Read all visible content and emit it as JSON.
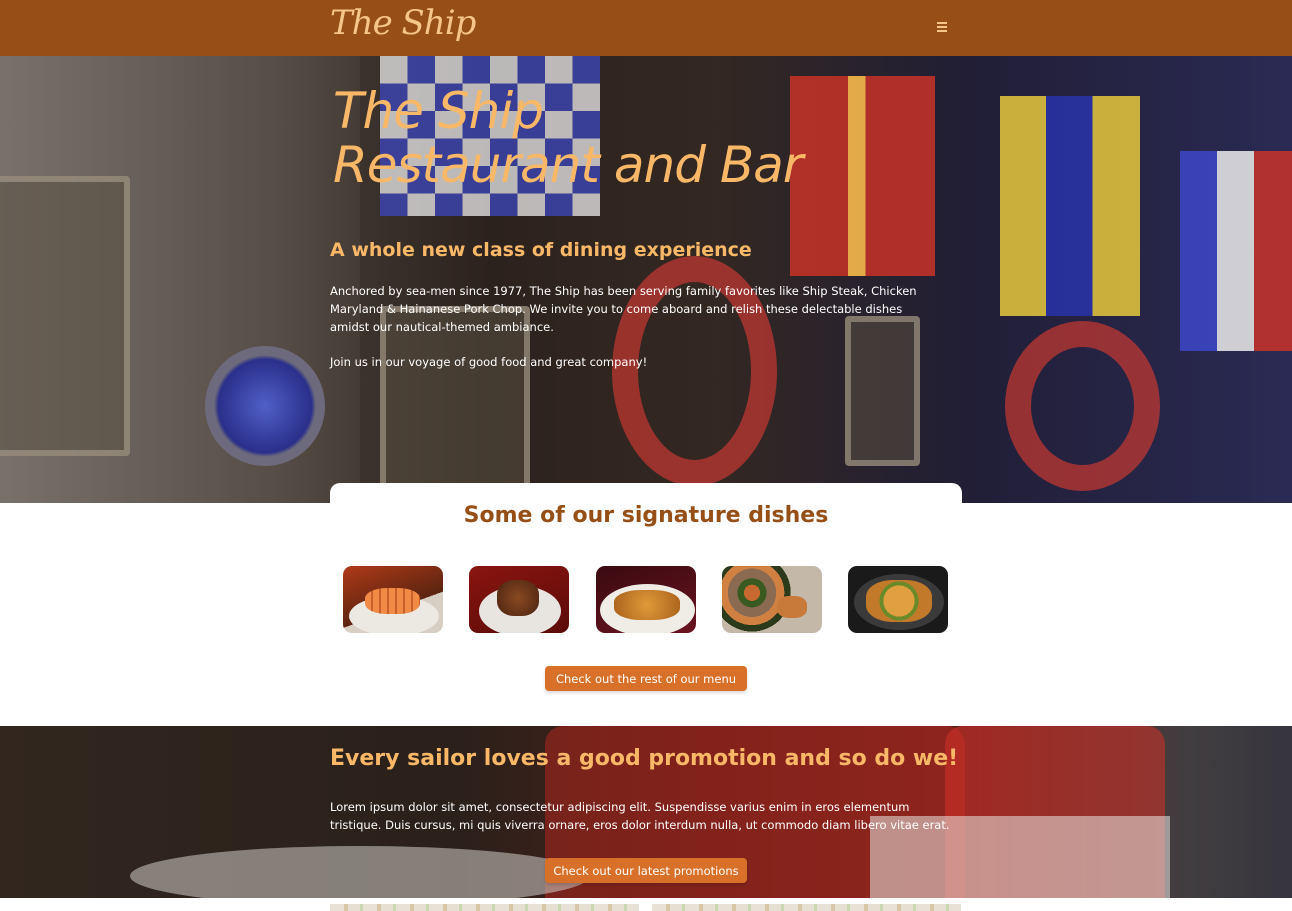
{
  "navbar": {
    "logo": "The Ship",
    "menu_icon": "hamburger-menu-icon"
  },
  "hero": {
    "title_line1": "The Ship",
    "title_line2": "Restaurant and Bar",
    "subtitle": "A whole new class of dining experience",
    "paragraph1": "Anchored by sea-men since 1977, The Ship has been serving family favorites like Ship Steak, Chicken Maryland & Hainanese Pork Chop. We invite you to come aboard and relish these delectable dishes amidst our nautical-themed ambiance.",
    "paragraph2": "Join us in our voyage of good food and great company!"
  },
  "signature": {
    "title": "Some of our signature dishes",
    "dishes": [
      {
        "name": "grilled-salmon-dish"
      },
      {
        "name": "braised-meat-dish"
      },
      {
        "name": "fried-cutlet-dish"
      },
      {
        "name": "baked-oysters-dish"
      },
      {
        "name": "herb-chicken-dish"
      }
    ],
    "button_label": "Check out the rest of our menu"
  },
  "promo": {
    "title": "Every sailor loves a good promotion and so do we!",
    "paragraph": "Lorem ipsum dolor sit amet, consectetur adipiscing elit. Suspendisse varius enim in eros elementum tristique. Duis cursus, mi quis viverra ornare, eros dolor interdum nulla, ut commodo diam libero vitae erat.",
    "button_label": "Check out our latest promotions"
  },
  "colors": {
    "nav_bg": "#964f16",
    "accent_text": "#f8b868",
    "button_bg": "#d9702a",
    "heading_brown": "#964f16"
  }
}
